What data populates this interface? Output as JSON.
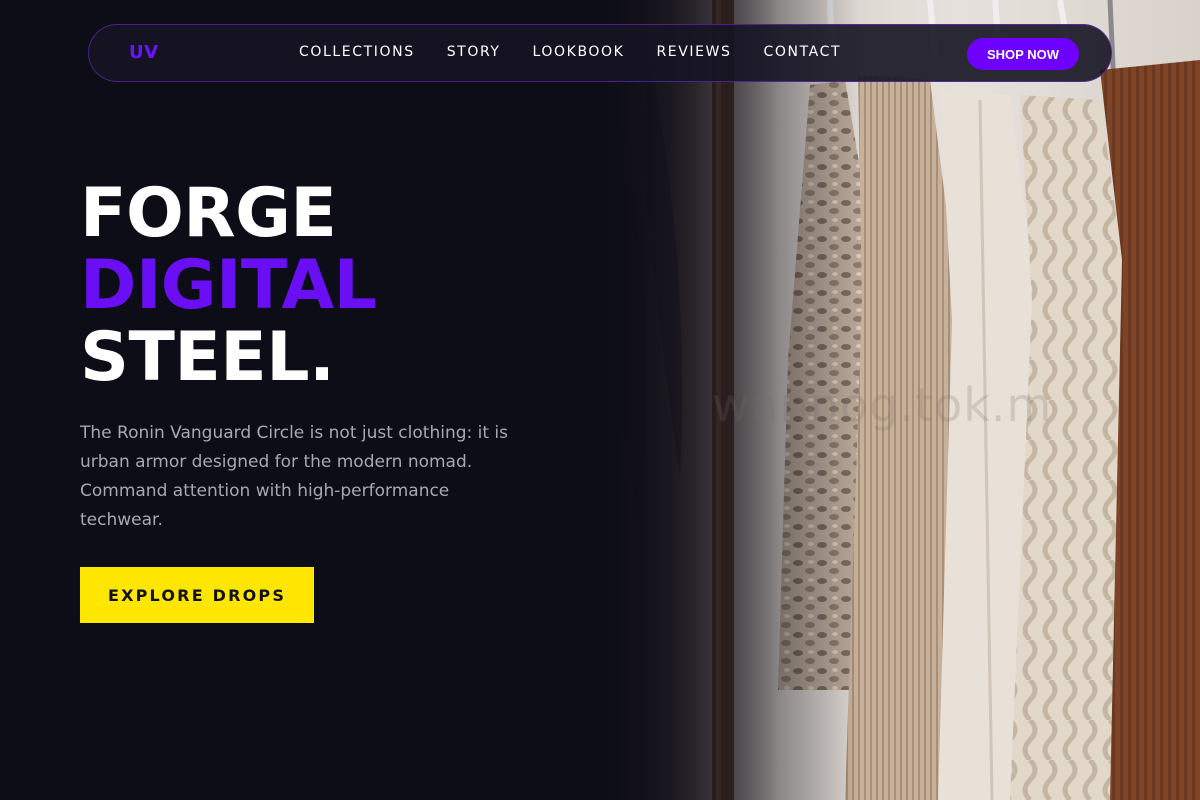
{
  "brand": {
    "logo": "UV",
    "accent": "#6d00ff",
    "cta_color": "#ffe600"
  },
  "nav": {
    "links": [
      "COLLECTIONS",
      "STORY",
      "LOOKBOOK",
      "REVIEWS",
      "CONTACT"
    ],
    "shop_label": "SHOP NOW"
  },
  "hero": {
    "headline": {
      "line1": "FORGE",
      "line2": "DIGITAL",
      "line3": "STEEL."
    },
    "intro": "The Ronin Vanguard Circle is not just clothing: it is urban armor designed for the modern nomad. Command attention with high-performance techwear.",
    "cta_label": "EXPLORE DROPS",
    "image": {
      "subject": "hanging-clothes-rack-photo"
    }
  }
}
